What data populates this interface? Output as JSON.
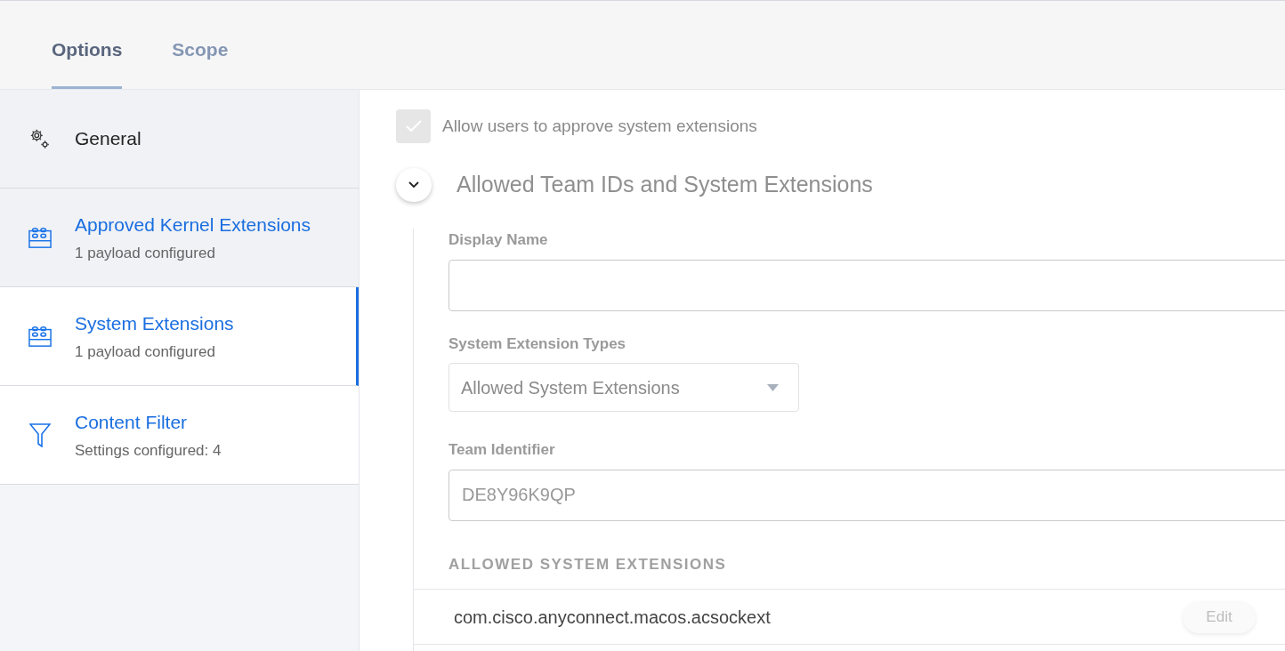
{
  "tabs": [
    {
      "label": "Options",
      "selected": true
    },
    {
      "label": "Scope",
      "selected": false
    }
  ],
  "sidebar": {
    "items": [
      {
        "kind": "general",
        "title": "General",
        "shaded": true,
        "selected": false
      },
      {
        "kind": "extension",
        "title": "Approved Kernel Extensions",
        "subtitle": "1 payload configured",
        "shaded": true,
        "selected": false
      },
      {
        "kind": "extension",
        "title": "System Extensions",
        "subtitle": "1 payload configured",
        "shaded": false,
        "selected": true
      },
      {
        "kind": "filter",
        "title": "Content Filter",
        "subtitle": "Settings configured: 4",
        "shaded": false,
        "selected": false
      }
    ]
  },
  "main": {
    "allow_checkbox": {
      "label": "Allow users to approve system extensions",
      "checked": true
    },
    "section": {
      "title": "Allowed Team IDs and System Extensions",
      "expanded": true,
      "display_name": {
        "label": "Display Name"
      },
      "extension_types": {
        "label": "System Extension Types",
        "value": "Allowed System Extensions"
      },
      "team_identifier": {
        "label": "Team Identifier",
        "value": "DE8Y96K9QP"
      },
      "allowed_heading": "ALLOWED SYSTEM EXTENSIONS",
      "extensions": [
        {
          "name": "com.cisco.anyconnect.macos.acsockext",
          "action": "Edit"
        }
      ]
    }
  }
}
